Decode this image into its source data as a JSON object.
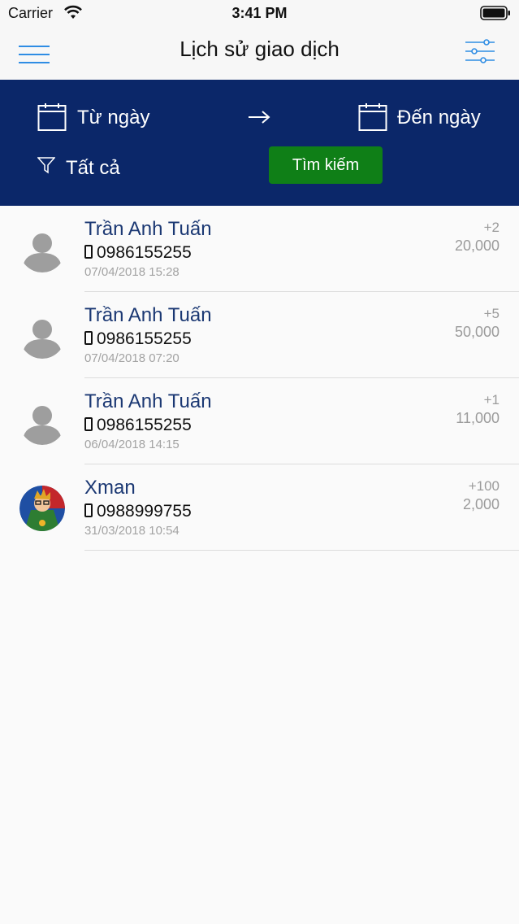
{
  "status_bar": {
    "carrier": "Carrier",
    "time": "3:41 PM"
  },
  "header": {
    "title": "Lịch sử giao dịch"
  },
  "filter": {
    "from_label": "Từ ngày",
    "to_label": "Đến ngày",
    "type_label": "Tất cả",
    "search_label": "Tìm kiếm"
  },
  "transactions": [
    {
      "name": "Trần Anh Tuấn",
      "phone": "0986155255",
      "datetime": "07/04/2018 15:28",
      "qty": "+2",
      "amount": "20,000",
      "avatar": "default-user-icon"
    },
    {
      "name": "Trần Anh Tuấn",
      "phone": "0986155255",
      "datetime": "07/04/2018 07:20",
      "qty": "+5",
      "amount": "50,000",
      "avatar": "default-user-icon"
    },
    {
      "name": "Trần Anh Tuấn",
      "phone": "0986155255",
      "datetime": "06/04/2018 14:15",
      "qty": "+1",
      "amount": "11,000",
      "avatar": "default-user-icon"
    },
    {
      "name": "Xman",
      "phone": "0988999755",
      "datetime": "31/03/2018 10:54",
      "qty": "+100",
      "amount": "2,000",
      "avatar": "xman-avatar"
    }
  ],
  "colors": {
    "header_bg": "#0b2769",
    "search_button": "#0f7f17",
    "name_text": "#1b3873",
    "accent_blue": "#2f8de4"
  }
}
